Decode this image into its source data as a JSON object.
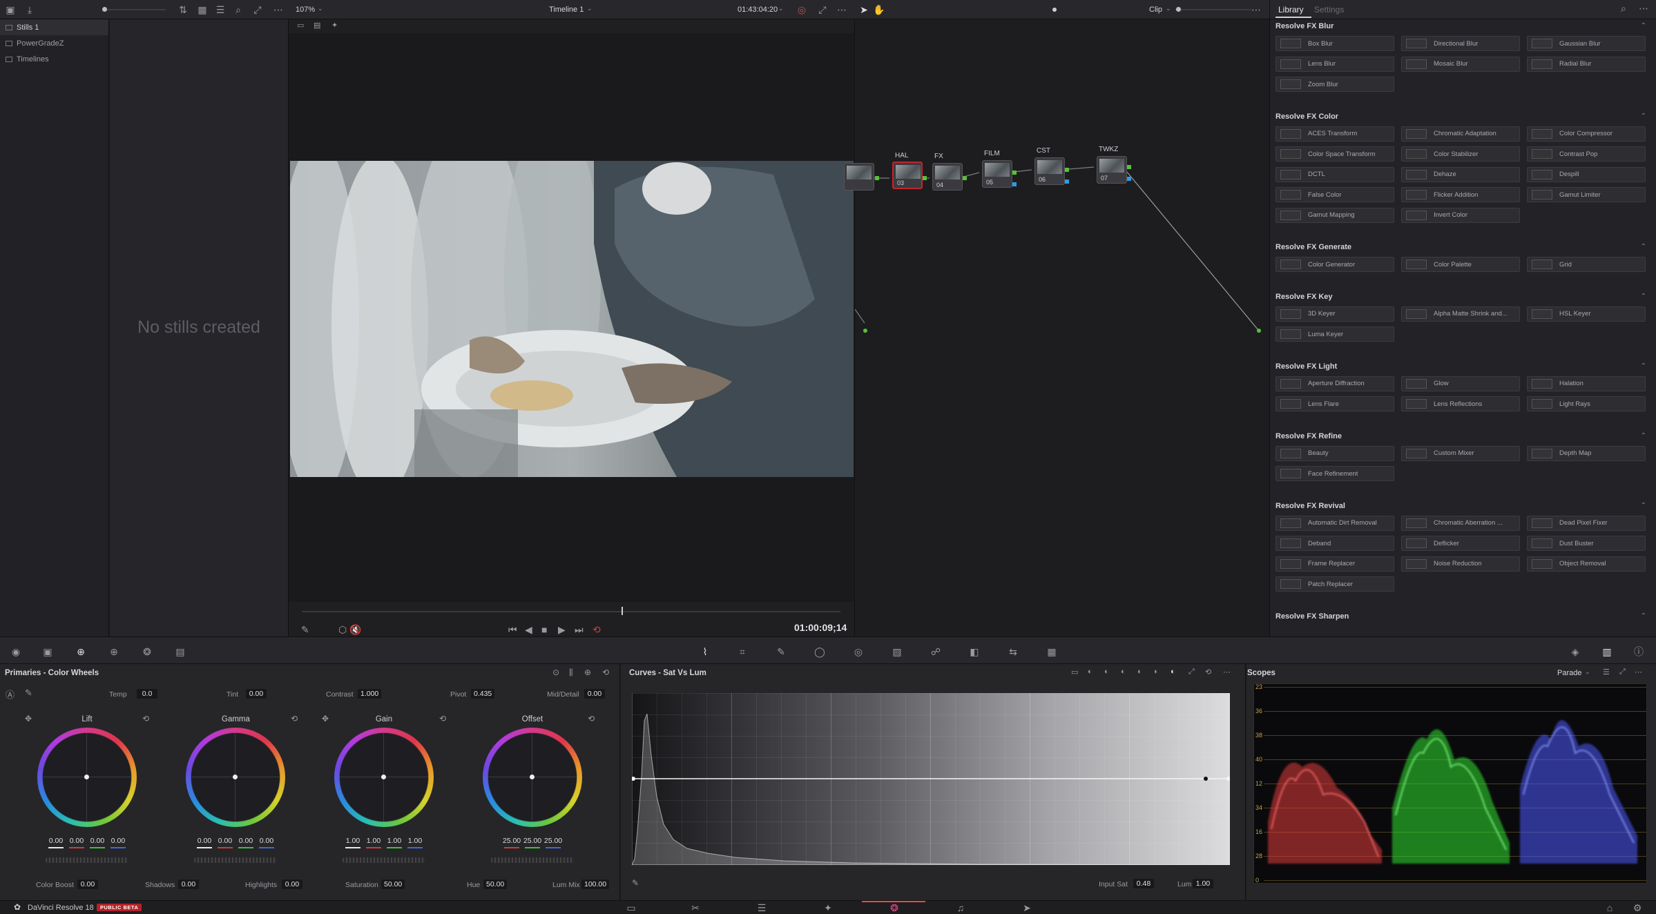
{
  "topbar": {
    "zoom": "107%",
    "timeline_name": "Timeline 1",
    "timecode": "01:43:04:20",
    "clip_mode": "Clip"
  },
  "gallery": {
    "albums": [
      {
        "label": "Stills 1",
        "active": true
      },
      {
        "label": "PowerGradeZ",
        "active": false
      },
      {
        "label": "Timelines",
        "active": false
      }
    ],
    "empty_message": "No stills created"
  },
  "viewer": {
    "timecode": "01:00:09;14",
    "playhead_fraction": 0.595
  },
  "nodes": [
    {
      "label": "",
      "num": ""
    },
    {
      "label": "HAL",
      "num": "03"
    },
    {
      "label": "FX",
      "num": "04"
    },
    {
      "label": "FILM",
      "num": "05"
    },
    {
      "label": "CST",
      "num": "06"
    },
    {
      "label": "TWKZ",
      "num": "07"
    }
  ],
  "library": {
    "tabs": [
      "Library",
      "Settings"
    ],
    "sections": [
      {
        "title": "Resolve FX Blur",
        "items": [
          "Box Blur",
          "Directional Blur",
          "Gaussian Blur",
          "Lens Blur",
          "Mosaic Blur",
          "Radial Blur",
          "Zoom Blur"
        ]
      },
      {
        "title": "Resolve FX Color",
        "items": [
          "ACES Transform",
          "Chromatic Adaptation",
          "Color Compressor",
          "Color Space Transform",
          "Color Stabilizer",
          "Contrast Pop",
          "DCTL",
          "Dehaze",
          "Despill",
          "False Color",
          "Flicker Addition",
          "Gamut Limiter",
          "Gamut Mapping",
          "Invert Color"
        ]
      },
      {
        "title": "Resolve FX Generate",
        "items": [
          "Color Generator",
          "Color Palette",
          "Grid"
        ]
      },
      {
        "title": "Resolve FX Key",
        "items": [
          "3D Keyer",
          "Alpha Matte Shrink and...",
          "HSL Keyer",
          "Luma Keyer"
        ]
      },
      {
        "title": "Resolve FX Light",
        "items": [
          "Aperture Diffraction",
          "Glow",
          "Halation",
          "Lens Flare",
          "Lens Reflections",
          "Light Rays"
        ]
      },
      {
        "title": "Resolve FX Refine",
        "items": [
          "Beauty",
          "Custom Mixer",
          "Depth Map",
          "Face Refinement"
        ]
      },
      {
        "title": "Resolve FX Revival",
        "items": [
          "Automatic Dirt Removal",
          "Chromatic Aberration ...",
          "Dead Pixel Fixer",
          "Deband",
          "Deflicker",
          "Dust Buster",
          "Frame Replacer",
          "Noise Reduction",
          "Object Removal",
          "Patch Replacer"
        ]
      },
      {
        "title": "Resolve FX Sharpen",
        "items": []
      }
    ]
  },
  "primaries": {
    "title": "Primaries - Color Wheels",
    "top_params": [
      {
        "label": "Temp",
        "value": "0.0"
      },
      {
        "label": "Tint",
        "value": "0.00"
      },
      {
        "label": "Contrast",
        "value": "1.000"
      },
      {
        "label": "Pivot",
        "value": "0.435"
      },
      {
        "label": "Mid/Detail",
        "value": "0.00"
      }
    ],
    "wheels": [
      {
        "name": "Lift",
        "values": [
          "0.00",
          "0.00",
          "0.00",
          "0.00"
        ]
      },
      {
        "name": "Gamma",
        "values": [
          "0.00",
          "0.00",
          "0.00",
          "0.00"
        ]
      },
      {
        "name": "Gain",
        "values": [
          "1.00",
          "1.00",
          "1.00",
          "1.00"
        ]
      },
      {
        "name": "Offset",
        "values": [
          "25.00",
          "25.00",
          "25.00"
        ]
      }
    ],
    "bottom_params": [
      {
        "label": "Color Boost",
        "value": "0.00"
      },
      {
        "label": "Shadows",
        "value": "0.00"
      },
      {
        "label": "Highlights",
        "value": "0.00"
      },
      {
        "label": "Saturation",
        "value": "50.00"
      },
      {
        "label": "Hue",
        "value": "50.00"
      },
      {
        "label": "Lum Mix",
        "value": "100.00"
      }
    ]
  },
  "curves": {
    "title": "Curves - Sat Vs Lum",
    "input_sat_label": "Input Sat",
    "input_sat_value": "0.48",
    "lum_label": "Lum",
    "lum_value": "1.00"
  },
  "scopes": {
    "title": "Scopes",
    "mode": "Parade",
    "scale_labels": [
      "23",
      "36",
      "38",
      "40",
      "12",
      "34",
      "16",
      "28",
      "0"
    ]
  },
  "status": {
    "app_name": "DaVinci Resolve 18",
    "badge": "PUBLIC BETA"
  },
  "colors": {
    "accent_red": "#c0262b",
    "node_green": "#56c23a",
    "node_blue": "#2b9ee0",
    "scope_gold": "#c8a24a"
  }
}
